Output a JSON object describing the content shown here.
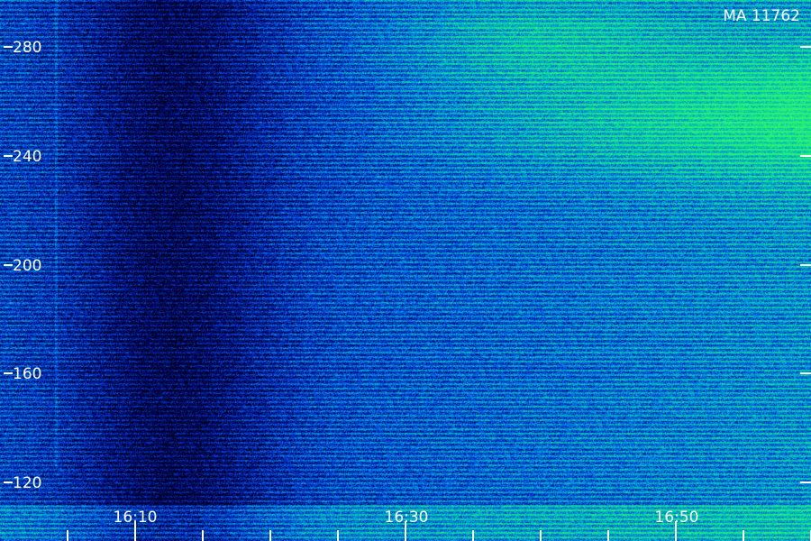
{
  "image": {
    "stamp": "MA 11762",
    "palette": [
      "#000022",
      "#0018a0",
      "#0050e0",
      "#00a0d8",
      "#00d8a0",
      "#30f070"
    ]
  },
  "y_axis": {
    "labels": [
      "280",
      "240",
      "200",
      "160",
      "120"
    ],
    "values": [
      280,
      240,
      200,
      160,
      120
    ]
  },
  "x_axis": {
    "labels": [
      "16:10",
      "16:30",
      "16:50"
    ],
    "minor_tick_count": 12
  }
}
